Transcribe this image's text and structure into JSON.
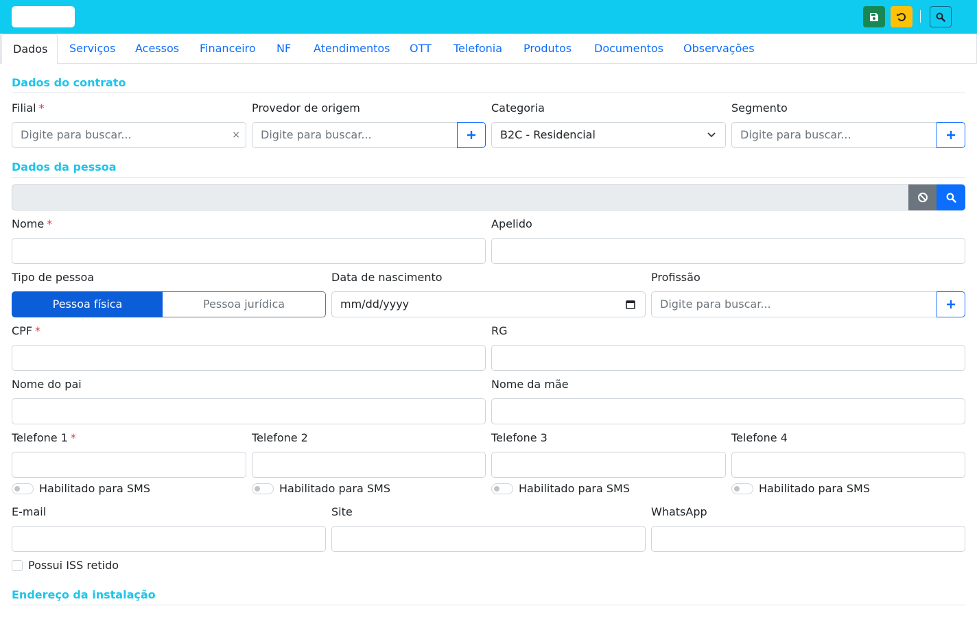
{
  "toolbar": {
    "save_icon": "floppy-disk-icon",
    "undo_icon": "undo-icon",
    "search_icon": "search-icon"
  },
  "tabs": [
    "Dados",
    "Serviços",
    "Acessos",
    "Financeiro",
    "NF",
    "Atendimentos",
    "OTT",
    "Telefonia",
    "Produtos",
    "Documentos",
    "Observações"
  ],
  "contract": {
    "title": "Dados do contrato",
    "filial_label": "Filial",
    "filial_placeholder": "Digite para buscar...",
    "filial_clear": "×",
    "provedor_label": "Provedor de origem",
    "provedor_placeholder": "Digite para buscar...",
    "categoria_label": "Categoria",
    "categoria_value": "B2C - Residencial",
    "segmento_label": "Segmento",
    "segmento_placeholder": "Digite para buscar..."
  },
  "person": {
    "title": "Dados da pessoa",
    "nome_label": "Nome",
    "apelido_label": "Apelido",
    "tipo_label": "Tipo de pessoa",
    "tipo_fisica": "Pessoa física",
    "tipo_juridica": "Pessoa jurídica",
    "nascimento_label": "Data de nascimento",
    "nascimento_placeholder": "mm/dd/yyyy",
    "profissao_label": "Profissão",
    "profissao_placeholder": "Digite para buscar...",
    "cpf_label": "CPF",
    "rg_label": "RG",
    "pai_label": "Nome do pai",
    "mae_label": "Nome da mãe",
    "telefone1_label": "Telefone 1",
    "telefone2_label": "Telefone 2",
    "telefone3_label": "Telefone 3",
    "telefone4_label": "Telefone 4",
    "sms_label": "Habilitado para SMS",
    "email_label": "E-mail",
    "site_label": "Site",
    "whatsapp_label": "WhatsApp",
    "iss_label": "Possui ISS retido",
    "required_mark": "*"
  },
  "address": {
    "title": "Endereço da instalação"
  },
  "colors": {
    "topbar": "#10cbf0",
    "accent": "#1ec5ea",
    "primary": "#0d6efd",
    "save": "#198754",
    "undo": "#ffc107"
  }
}
